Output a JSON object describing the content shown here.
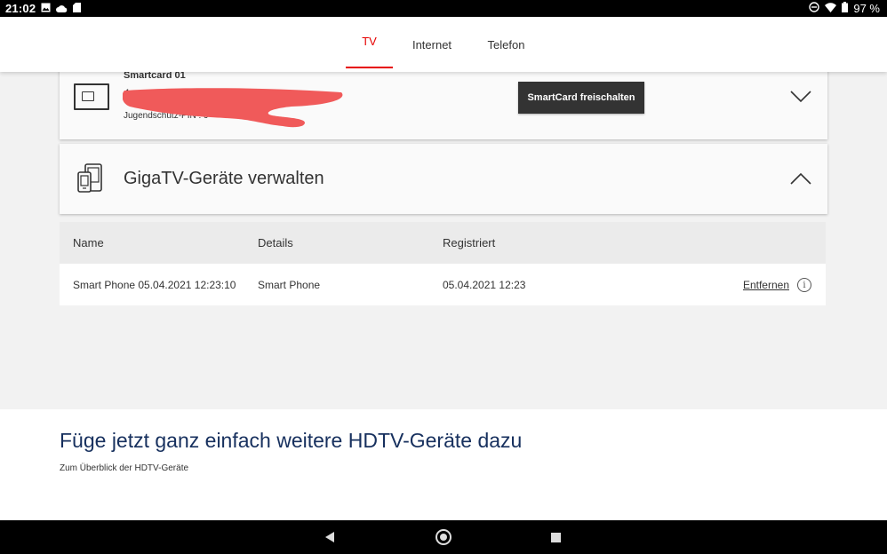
{
  "status_bar": {
    "time": "21:02",
    "battery": "97 %",
    "left_icons": [
      "image-icon",
      "cloud-icon",
      "sd-card-icon"
    ],
    "right_icons": [
      "dnd-icon",
      "wifi-icon",
      "battery-icon"
    ]
  },
  "tabs": [
    {
      "label": "TV",
      "active": true
    },
    {
      "label": "Internet",
      "active": false
    },
    {
      "label": "Telefon",
      "active": false
    }
  ],
  "smartcard": {
    "title": "Smartcard 01",
    "number": "4",
    "pin_label": "Jugendschutz-PIN : 9",
    "unlock_button": "SmartCard freischalten",
    "expanded": false
  },
  "gigatv": {
    "title": "GigaTV-Geräte verwalten",
    "expanded": true
  },
  "devices_table": {
    "headers": [
      "Name",
      "Details",
      "Registriert"
    ],
    "rows": [
      {
        "name": "Smart Phone 05.04.2021 12:23:10",
        "details": "Smart Phone",
        "registered": "05.04.2021 12:23",
        "action": "Entfernen"
      }
    ]
  },
  "promo": {
    "title": "Füge jetzt ganz einfach weitere HDTV-Geräte dazu",
    "link": "Zum Überblick der HDTV-Geräte"
  },
  "colors": {
    "accent_red": "#e60000",
    "promo_blue": "#17305e",
    "button_dark": "#333333",
    "redaction": "#f05a5a"
  }
}
